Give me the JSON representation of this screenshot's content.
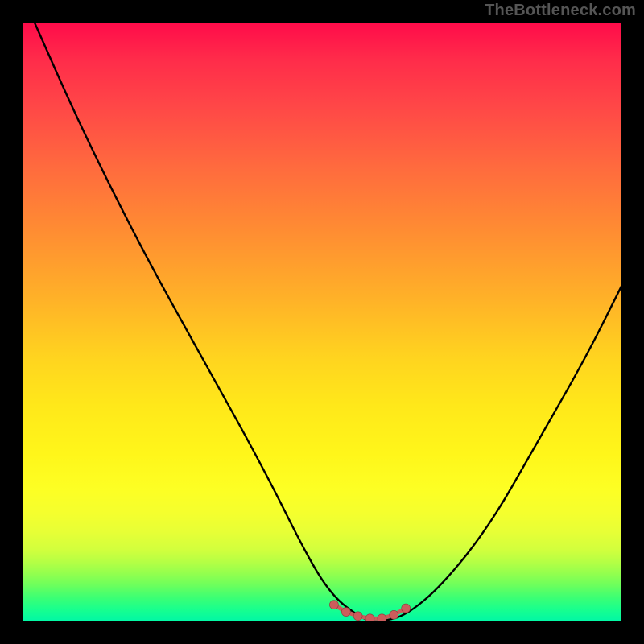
{
  "watermark": "TheBottleneck.com",
  "chart_data": {
    "type": "line",
    "title": "",
    "xlabel": "",
    "ylabel": "",
    "xlim": [
      0,
      100
    ],
    "ylim": [
      0,
      100
    ],
    "grid": false,
    "series": [
      {
        "name": "bottleneck-curve",
        "x": [
          2,
          10,
          20,
          30,
          40,
          48,
          52,
          56,
          58,
          60,
          64,
          70,
          78,
          86,
          94,
          100
        ],
        "y": [
          100,
          82,
          62,
          44,
          26,
          10,
          4,
          1,
          0,
          0,
          1,
          6,
          16,
          30,
          44,
          56
        ]
      }
    ],
    "highlighted_segment": {
      "name": "trough-markers",
      "x": [
        52,
        54,
        56,
        58,
        60,
        62,
        64
      ],
      "y": [
        2.8,
        1.6,
        0.9,
        0.5,
        0.5,
        1.1,
        2.2
      ]
    },
    "color_axis": {
      "top": "#ff0b4a",
      "bottom": "#00f7a6",
      "meaning": "high-to-low-bottleneck"
    }
  }
}
